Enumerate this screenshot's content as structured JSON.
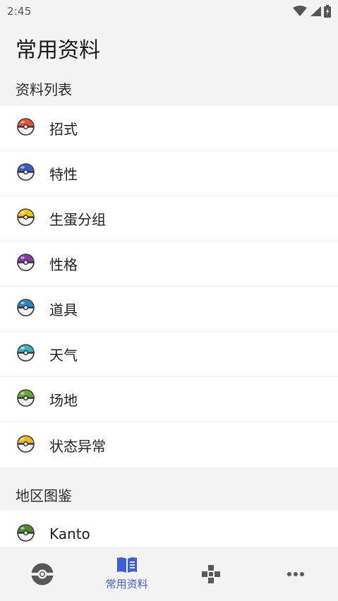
{
  "status_bar": {
    "time": "2:45"
  },
  "page": {
    "title": "常用资料"
  },
  "sections": {
    "data_list": {
      "header": "资料列表",
      "items": [
        {
          "label": "招式",
          "icon": "poke-ball-icon",
          "color": "#e8552a"
        },
        {
          "label": "特性",
          "icon": "great-ball-icon",
          "color": "#3a5bd0"
        },
        {
          "label": "生蛋分组",
          "icon": "ultra-ball-icon",
          "color": "#f2c51c"
        },
        {
          "label": "性格",
          "icon": "master-ball-icon",
          "color": "#8a3aa8"
        },
        {
          "label": "道具",
          "icon": "dive-ball-icon",
          "color": "#2a86c8"
        },
        {
          "label": "天气",
          "icon": "net-ball-icon",
          "color": "#3cb0bf"
        },
        {
          "label": "场地",
          "icon": "friend-ball-icon",
          "color": "#6aa834"
        },
        {
          "label": "状态异常",
          "icon": "level-ball-icon",
          "color": "#f0b820"
        }
      ]
    },
    "regional_dex": {
      "header": "地区图鉴",
      "items": [
        {
          "label": "Kanto",
          "icon": "safari-ball-icon",
          "color": "#4a8a2a"
        }
      ]
    }
  },
  "bottom_nav": {
    "active_color": "#3d5fd6",
    "items": [
      {
        "name": "pokeball",
        "label": "",
        "icon": "pokeball-outline-icon"
      },
      {
        "name": "common-data",
        "label": "常用资料",
        "icon": "book-icon"
      },
      {
        "name": "games",
        "label": "",
        "icon": "gamepad-icon"
      },
      {
        "name": "more",
        "label": "",
        "icon": "more-dots-icon"
      }
    ]
  }
}
